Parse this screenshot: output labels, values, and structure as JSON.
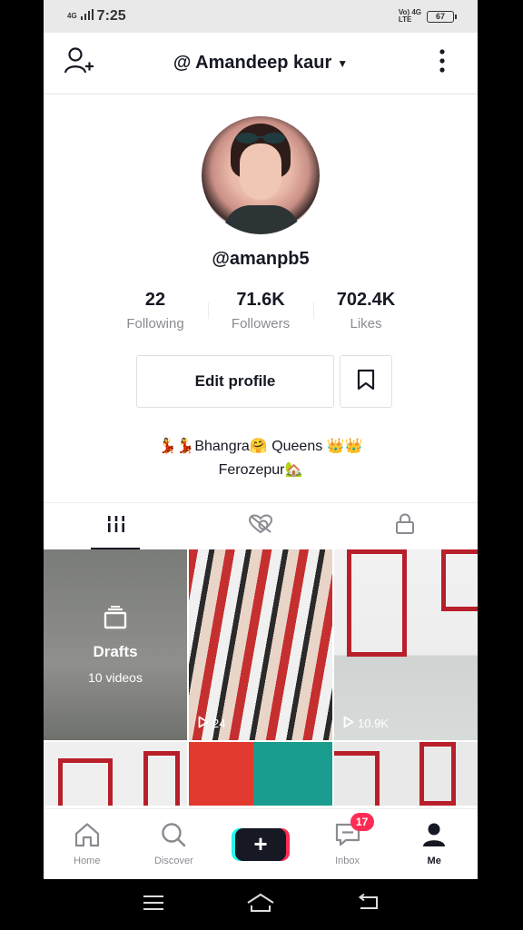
{
  "status_bar": {
    "network_left": "4G",
    "time": "7:25",
    "network_right_top": "Vo) 4G",
    "network_right_bottom": "LTE",
    "battery": "67"
  },
  "header": {
    "title": "@ Amandeep kaur",
    "add_user_icon": "add-user-icon",
    "more_icon": "more-vertical-icon"
  },
  "profile": {
    "username": "@amanpb5",
    "stats": [
      {
        "value": "22",
        "label": "Following"
      },
      {
        "value": "71.6K",
        "label": "Followers"
      },
      {
        "value": "702.4K",
        "label": "Likes"
      }
    ],
    "edit_profile_label": "Edit profile",
    "bio_line1": "💃💃Bhangra🤗 Queens 👑👑",
    "bio_line2": "Ferozepur🏡"
  },
  "tabs": [
    "videos-grid-icon",
    "liked-private-icon",
    "lock-icon"
  ],
  "grid": {
    "drafts_title": "Drafts",
    "drafts_sub": "10 videos",
    "video2_views": "24",
    "video3_views": "10.9K"
  },
  "bottom_nav": {
    "items": [
      {
        "label": "Home",
        "icon": "home-icon"
      },
      {
        "label": "Discover",
        "icon": "search-icon"
      },
      {
        "label": "",
        "icon": "create-plus-icon"
      },
      {
        "label": "Inbox",
        "icon": "inbox-icon",
        "badge": "17"
      },
      {
        "label": "Me",
        "icon": "profile-icon"
      }
    ],
    "plus_symbol": "+"
  }
}
